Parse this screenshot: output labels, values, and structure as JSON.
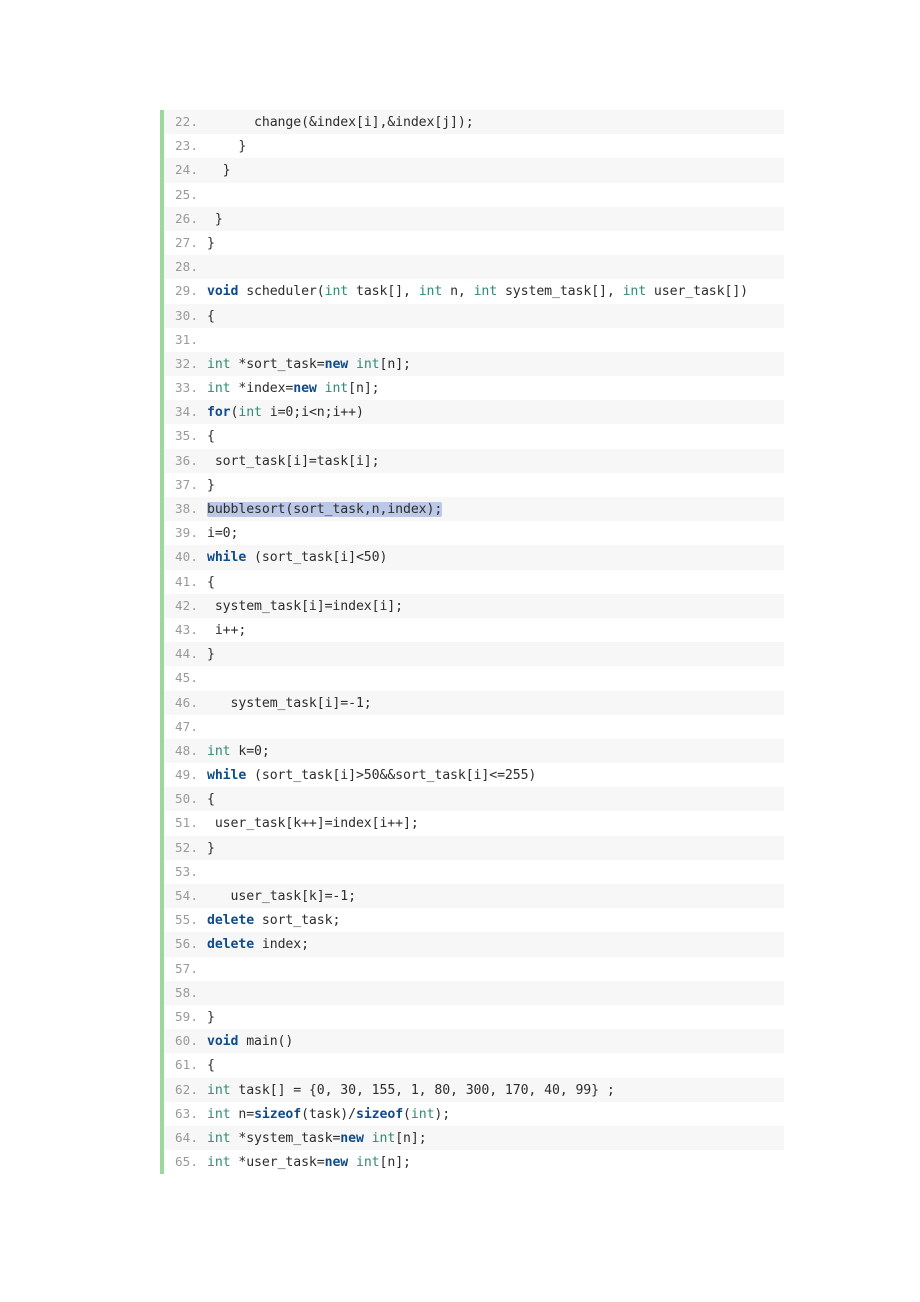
{
  "code_block": {
    "language": "cpp",
    "accent_border_color": "#9cd89c",
    "stripe_color": "#f7f7f7",
    "selection_color": "#bcc8e8",
    "keyword_color": "#0f4c8c",
    "type_color": "#2e8b74",
    "text_color": "#2d2d2d",
    "line_number_color": "#9a9a9a",
    "first_line_number": 22,
    "last_line_number": 65,
    "lines": [
      {
        "n": "22",
        "tokens": [
          {
            "t": "      change(&index[i],&index[j]);",
            "c": "plain"
          }
        ]
      },
      {
        "n": "23",
        "tokens": [
          {
            "t": "    }",
            "c": "plain"
          }
        ]
      },
      {
        "n": "24",
        "tokens": [
          {
            "t": "  }",
            "c": "plain"
          }
        ]
      },
      {
        "n": "25",
        "tokens": [
          {
            "t": "",
            "c": "plain"
          }
        ]
      },
      {
        "n": "26",
        "tokens": [
          {
            "t": " }",
            "c": "plain"
          }
        ]
      },
      {
        "n": "27",
        "tokens": [
          {
            "t": "}",
            "c": "plain"
          }
        ]
      },
      {
        "n": "28",
        "tokens": [
          {
            "t": "",
            "c": "plain"
          }
        ]
      },
      {
        "n": "29",
        "tokens": [
          {
            "t": "void",
            "c": "kw"
          },
          {
            "t": " scheduler(",
            "c": "plain"
          },
          {
            "t": "int",
            "c": "type"
          },
          {
            "t": " task[], ",
            "c": "plain"
          },
          {
            "t": "int",
            "c": "type"
          },
          {
            "t": " n, ",
            "c": "plain"
          },
          {
            "t": "int",
            "c": "type"
          },
          {
            "t": " system_task[], ",
            "c": "plain"
          },
          {
            "t": "int",
            "c": "type"
          },
          {
            "t": " user_task[])",
            "c": "plain"
          }
        ]
      },
      {
        "n": "30",
        "tokens": [
          {
            "t": "{",
            "c": "plain"
          }
        ]
      },
      {
        "n": "31",
        "tokens": [
          {
            "t": "",
            "c": "plain"
          }
        ]
      },
      {
        "n": "32",
        "tokens": [
          {
            "t": "int",
            "c": "type"
          },
          {
            "t": " *sort_task=",
            "c": "plain"
          },
          {
            "t": "new",
            "c": "kw"
          },
          {
            "t": " ",
            "c": "plain"
          },
          {
            "t": "int",
            "c": "type"
          },
          {
            "t": "[n];",
            "c": "plain"
          }
        ]
      },
      {
        "n": "33",
        "tokens": [
          {
            "t": "int",
            "c": "type"
          },
          {
            "t": " *index=",
            "c": "plain"
          },
          {
            "t": "new",
            "c": "kw"
          },
          {
            "t": " ",
            "c": "plain"
          },
          {
            "t": "int",
            "c": "type"
          },
          {
            "t": "[n];",
            "c": "plain"
          }
        ]
      },
      {
        "n": "34",
        "tokens": [
          {
            "t": "for",
            "c": "kw"
          },
          {
            "t": "(",
            "c": "plain"
          },
          {
            "t": "int",
            "c": "type"
          },
          {
            "t": " i=0;i<n;i++)",
            "c": "plain"
          }
        ]
      },
      {
        "n": "35",
        "tokens": [
          {
            "t": "{",
            "c": "plain"
          }
        ]
      },
      {
        "n": "36",
        "tokens": [
          {
            "t": " sort_task[i]=task[i];",
            "c": "plain"
          }
        ]
      },
      {
        "n": "37",
        "tokens": [
          {
            "t": "}",
            "c": "plain"
          }
        ]
      },
      {
        "n": "38",
        "tokens": [
          {
            "t": "bubblesort(sort_task,n,index);",
            "c": "sel"
          }
        ]
      },
      {
        "n": "39",
        "tokens": [
          {
            "t": "i=0;",
            "c": "plain"
          }
        ]
      },
      {
        "n": "40",
        "tokens": [
          {
            "t": "while",
            "c": "kw"
          },
          {
            "t": " (sort_task[i]<50)",
            "c": "plain"
          }
        ]
      },
      {
        "n": "41",
        "tokens": [
          {
            "t": "{",
            "c": "plain"
          }
        ]
      },
      {
        "n": "42",
        "tokens": [
          {
            "t": " system_task[i]=index[i];",
            "c": "plain"
          }
        ]
      },
      {
        "n": "43",
        "tokens": [
          {
            "t": " i++;",
            "c": "plain"
          }
        ]
      },
      {
        "n": "44",
        "tokens": [
          {
            "t": "}",
            "c": "plain"
          }
        ]
      },
      {
        "n": "45",
        "tokens": [
          {
            "t": "",
            "c": "plain"
          }
        ]
      },
      {
        "n": "46",
        "tokens": [
          {
            "t": "   system_task[i]=-1;",
            "c": "plain"
          }
        ]
      },
      {
        "n": "47",
        "tokens": [
          {
            "t": "",
            "c": "plain"
          }
        ]
      },
      {
        "n": "48",
        "tokens": [
          {
            "t": "int",
            "c": "type"
          },
          {
            "t": " k=0;",
            "c": "plain"
          }
        ]
      },
      {
        "n": "49",
        "tokens": [
          {
            "t": "while",
            "c": "kw"
          },
          {
            "t": " (sort_task[i]>50&&sort_task[i]<=255)",
            "c": "plain"
          }
        ]
      },
      {
        "n": "50",
        "tokens": [
          {
            "t": "{",
            "c": "plain"
          }
        ]
      },
      {
        "n": "51",
        "tokens": [
          {
            "t": " user_task[k++]=index[i++];",
            "c": "plain"
          }
        ]
      },
      {
        "n": "52",
        "tokens": [
          {
            "t": "}",
            "c": "plain"
          }
        ]
      },
      {
        "n": "53",
        "tokens": [
          {
            "t": "",
            "c": "plain"
          }
        ]
      },
      {
        "n": "54",
        "tokens": [
          {
            "t": "   user_task[k]=-1;",
            "c": "plain"
          }
        ]
      },
      {
        "n": "55",
        "tokens": [
          {
            "t": "delete",
            "c": "kw"
          },
          {
            "t": " sort_task;",
            "c": "plain"
          }
        ]
      },
      {
        "n": "56",
        "tokens": [
          {
            "t": "delete",
            "c": "kw"
          },
          {
            "t": " index;",
            "c": "plain"
          }
        ]
      },
      {
        "n": "57",
        "tokens": [
          {
            "t": "",
            "c": "plain"
          }
        ]
      },
      {
        "n": "58",
        "tokens": [
          {
            "t": "",
            "c": "plain"
          }
        ]
      },
      {
        "n": "59",
        "tokens": [
          {
            "t": "}",
            "c": "plain"
          }
        ]
      },
      {
        "n": "60",
        "tokens": [
          {
            "t": "void",
            "c": "kw"
          },
          {
            "t": " main()",
            "c": "plain"
          }
        ]
      },
      {
        "n": "61",
        "tokens": [
          {
            "t": "{",
            "c": "plain"
          }
        ]
      },
      {
        "n": "62",
        "tokens": [
          {
            "t": "int",
            "c": "type"
          },
          {
            "t": " task[] = {0, 30, 155, 1, 80, 300, 170, 40, 99} ;",
            "c": "plain"
          }
        ]
      },
      {
        "n": "63",
        "tokens": [
          {
            "t": "int",
            "c": "type"
          },
          {
            "t": " n=",
            "c": "plain"
          },
          {
            "t": "sizeof",
            "c": "kw"
          },
          {
            "t": "(task)/",
            "c": "plain"
          },
          {
            "t": "sizeof",
            "c": "kw"
          },
          {
            "t": "(",
            "c": "plain"
          },
          {
            "t": "int",
            "c": "type"
          },
          {
            "t": ");",
            "c": "plain"
          }
        ]
      },
      {
        "n": "64",
        "tokens": [
          {
            "t": "int",
            "c": "type"
          },
          {
            "t": " *system_task=",
            "c": "plain"
          },
          {
            "t": "new",
            "c": "kw"
          },
          {
            "t": " ",
            "c": "plain"
          },
          {
            "t": "int",
            "c": "type"
          },
          {
            "t": "[n];",
            "c": "plain"
          }
        ]
      },
      {
        "n": "65",
        "tokens": [
          {
            "t": "int",
            "c": "type"
          },
          {
            "t": " *user_task=",
            "c": "plain"
          },
          {
            "t": "new",
            "c": "kw"
          },
          {
            "t": " ",
            "c": "plain"
          },
          {
            "t": "int",
            "c": "type"
          },
          {
            "t": "[n];",
            "c": "plain"
          }
        ]
      }
    ]
  }
}
